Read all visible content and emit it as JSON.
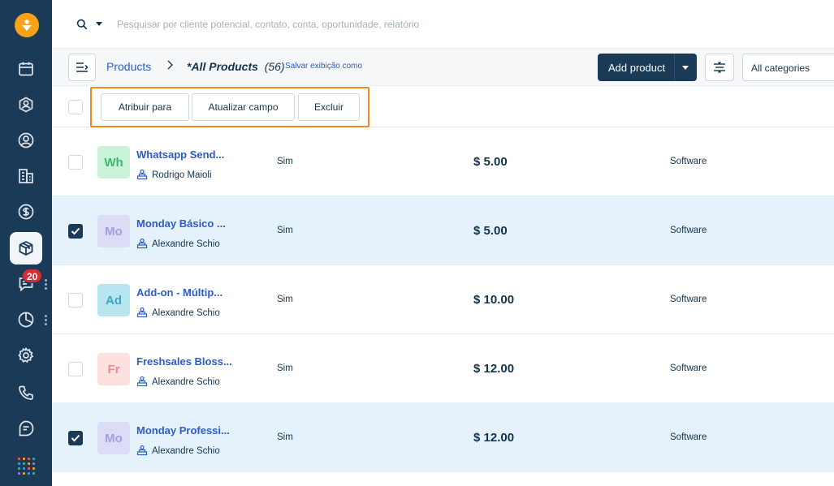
{
  "search": {
    "placeholder": "Pesquisar por cliente potencial, contato, conta, oportunidade, relatório"
  },
  "sidebar": {
    "items": [
      {
        "name": "calendar-icon"
      },
      {
        "name": "contact-circle-icon"
      },
      {
        "name": "user-icon"
      },
      {
        "name": "building-icon"
      },
      {
        "name": "dollar-icon"
      },
      {
        "name": "product-box-icon",
        "active": true
      },
      {
        "name": "chat-icon",
        "badge": "20"
      },
      {
        "name": "pie-chart-icon"
      },
      {
        "name": "gear-icon"
      },
      {
        "name": "phone-icon"
      },
      {
        "name": "note-icon"
      },
      {
        "name": "apps-grid-icon"
      }
    ]
  },
  "header": {
    "breadcrumb_root": "Products",
    "view_name": "*All Products",
    "view_count": "(56)",
    "save_view_label": "Salvar exibição como",
    "add_product_label": "Add product",
    "category_filter": "All categories"
  },
  "bulk_actions": {
    "assign_label": "Atribuir para",
    "update_field_label": "Atualizar campo",
    "delete_label": "Excluir"
  },
  "rows": [
    {
      "initials": "Wh",
      "name": "Whatsapp Send...",
      "owner": "Rodrigo Maioli",
      "active": "Sim",
      "price": "$ 5.00",
      "category": "Software",
      "checked": false,
      "avatar_bg": "#c9f2d8",
      "avatar_fg": "#3cb371"
    },
    {
      "initials": "Mo",
      "name": "Monday Básico ...",
      "owner": "Alexandre Schio",
      "active": "Sim",
      "price": "$ 5.00",
      "category": "Software",
      "checked": true,
      "avatar_bg": "#dcdcf7",
      "avatar_fg": "#9e9ee0"
    },
    {
      "initials": "Ad",
      "name": "Add-on - Múltip...",
      "owner": "Alexandre Schio",
      "active": "Sim",
      "price": "$ 10.00",
      "category": "Software",
      "checked": false,
      "avatar_bg": "#b9e5ee",
      "avatar_fg": "#3ba6c4"
    },
    {
      "initials": "Fr",
      "name": "Freshsales Bloss...",
      "owner": "Alexandre Schio",
      "active": "Sim",
      "price": "$ 12.00",
      "category": "Software",
      "checked": false,
      "avatar_bg": "#fde0e0",
      "avatar_fg": "#f08a8a"
    },
    {
      "initials": "Mo",
      "name": "Monday Professi...",
      "owner": "Alexandre Schio",
      "active": "Sim",
      "price": "$ 12.00",
      "category": "Software",
      "checked": true,
      "avatar_bg": "#dcdcf7",
      "avatar_fg": "#9e9ee0"
    }
  ],
  "colors": {
    "sidebar": "#1b3a57",
    "link": "#2c5cc5",
    "highlight_frame": "#f0891a",
    "selected_row": "#e6f2fb"
  }
}
